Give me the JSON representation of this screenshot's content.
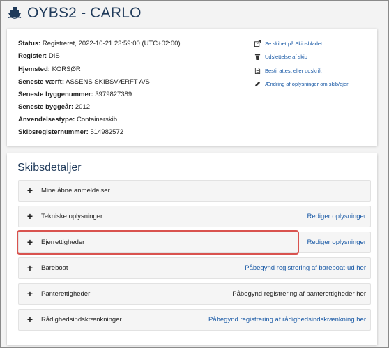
{
  "header": {
    "title": "OYBS2 - CARLO",
    "icon": "ship-icon"
  },
  "info": {
    "rows": [
      {
        "label": "Status:",
        "value": "Registreret, 2022-10-21 23:59:00 (UTC+02:00)"
      },
      {
        "label": "Register:",
        "value": "DIS"
      },
      {
        "label": "Hjemsted:",
        "value": "KORSØR"
      },
      {
        "label": "Seneste værft:",
        "value": "ASSENS SKIBSVÆRFT A/S"
      },
      {
        "label": "Seneste byggenummer:",
        "value": "3979827389"
      },
      {
        "label": "Seneste byggeår:",
        "value": "2012"
      },
      {
        "label": "Anvendelsestype:",
        "value": "Containerskib"
      },
      {
        "label": "Skibsregisternummer:",
        "value": "514982572"
      }
    ],
    "actions": [
      {
        "label": "Se skibet på Skibsbladet",
        "icon": "external-link-icon"
      },
      {
        "label": "Udslettelse af skib",
        "icon": "trash-icon"
      },
      {
        "label": "Bestil attest eller udskrift",
        "icon": "document-icon"
      },
      {
        "label": "Ændring af oplysninger om skib/ejer",
        "icon": "pencil-icon"
      }
    ]
  },
  "details": {
    "title": "Skibsdetaljer",
    "sections": [
      {
        "label": "Mine åbne anmeldelser",
        "action": ""
      },
      {
        "label": "Tekniske oplysninger",
        "action": "Rediger oplysninger"
      },
      {
        "label": "Ejerrettigheder",
        "action": "Rediger oplysninger"
      },
      {
        "label": "Bareboat",
        "action": "Påbegynd registrering af bareboat-ud her"
      },
      {
        "label": "Panterettigheder",
        "action": "Påbegynd registrering af panterettigheder her"
      },
      {
        "label": "Rådighedsindskrænkninger",
        "action": "Påbegynd registrering af rådighedsindskrænkning her"
      }
    ],
    "expand_symbol": "+"
  },
  "colors": {
    "title": "#1f3a5a",
    "link": "#1a5aa6",
    "highlight": "#d9534f"
  }
}
